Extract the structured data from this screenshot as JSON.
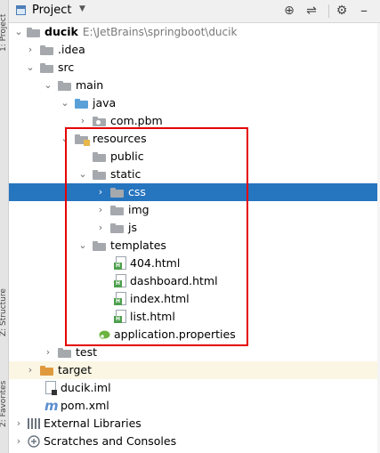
{
  "side_tabs": {
    "project": "1: Project",
    "structure": "Z: Structure",
    "favorites": "2: Favorites"
  },
  "header": {
    "title": "Project",
    "dropdown_icon": "caret-down-icon",
    "toolbar_icons": [
      "crosshair-icon",
      "collapse-icon",
      "gear-icon",
      "minimize-icon"
    ]
  },
  "tree": {
    "ducik": {
      "name": "ducik",
      "path": "E:\\JetBrains\\springboot\\ducik"
    },
    "idea": "idea",
    "src": "src",
    "main": "main",
    "java": "java",
    "com_pbm": "com.pbm",
    "resources": "resources",
    "public": "public",
    "static": "static",
    "css": "css",
    "img": "img",
    "js": "js",
    "templates": "templates",
    "f404": "404.html",
    "dashboard": "dashboard.html",
    "index": "index.html",
    "list": "list.html",
    "app_props": "application.properties",
    "test": "test",
    "target": "target",
    "ducik_iml": "ducik.iml",
    "pom": "pom.xml",
    "ext_libs": "External Libraries",
    "scratches": "Scratches and Consoles"
  },
  "colors": {
    "selection": "#2675bf",
    "highlight_box": "#e50000",
    "folder_grey": "#a5a8ac",
    "folder_blue": "#5aa0d8",
    "folder_orange": "#e09a3e"
  }
}
